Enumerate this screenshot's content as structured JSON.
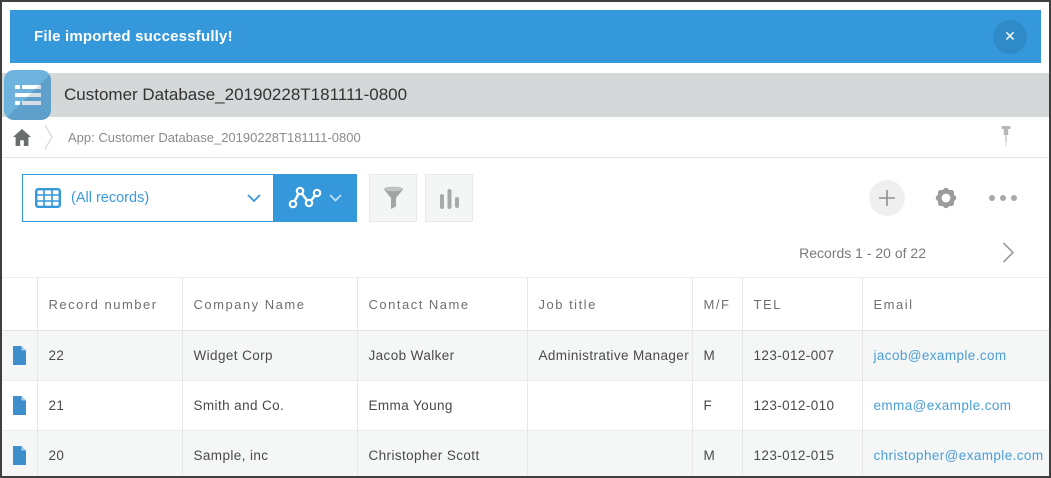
{
  "banner": {
    "message": "File imported successfully!"
  },
  "app": {
    "title": "Customer Database_20190228T181111-0800"
  },
  "breadcrumb": {
    "label": "App: Customer Database_20190228T181111-0800"
  },
  "toolbar": {
    "view_selector": {
      "value": "(All records)"
    }
  },
  "pagination": {
    "summary": "Records 1 - 20 of 22"
  },
  "table": {
    "columns": [
      "Record number",
      "Company Name",
      "Contact Name",
      "Job title",
      "M/F",
      "TEL",
      "Email"
    ],
    "rows": [
      {
        "record_number": "22",
        "company_name": "Widget Corp",
        "contact_name": "Jacob Walker",
        "job_title": "Administrative Manager",
        "mf": "M",
        "tel": "123-012-007",
        "email": "jacob@example.com"
      },
      {
        "record_number": "21",
        "company_name": "Smith and Co.",
        "contact_name": "Emma Young",
        "job_title": "",
        "mf": "F",
        "tel": "123-012-010",
        "email": "emma@example.com"
      },
      {
        "record_number": "20",
        "company_name": "Sample, inc",
        "contact_name": "Christopher Scott",
        "job_title": "",
        "mf": "M",
        "tel": "123-012-015",
        "email": "christopher@example.com"
      }
    ]
  },
  "icons": {
    "close": "✕"
  },
  "colors": {
    "accent_blue": "#3498db",
    "link_blue": "#4a9ed7",
    "header_bar_gray": "#d4d8d9",
    "shaded_row": "#f5f6f6"
  }
}
